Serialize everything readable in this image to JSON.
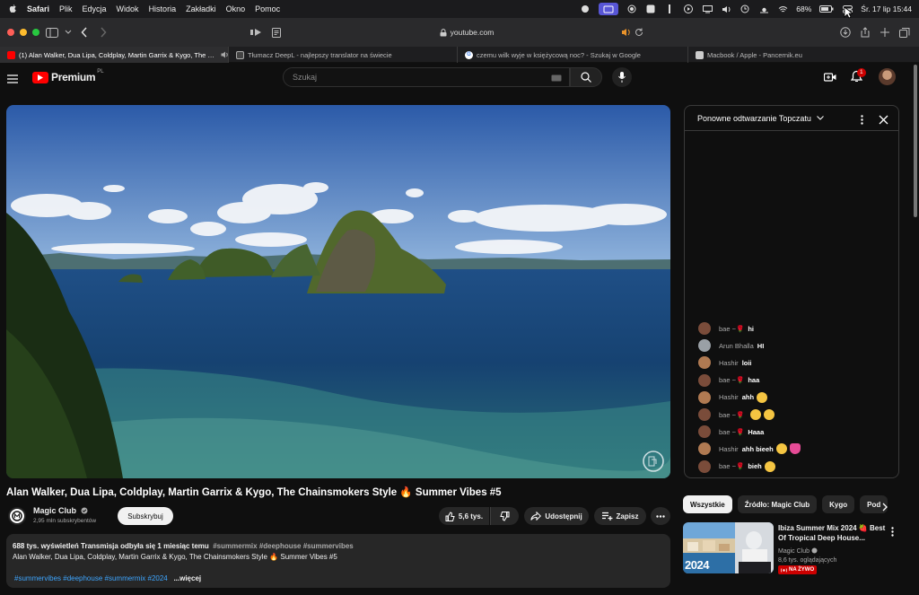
{
  "menubar": {
    "items": [
      "Safari",
      "Plik",
      "Edycja",
      "Widok",
      "Historia",
      "Zakładki",
      "Okno",
      "Pomoc"
    ],
    "battery": "68%",
    "datetime": "Śr. 17 lip  15:44"
  },
  "browser": {
    "url": "youtube.com",
    "tabs": [
      {
        "title": "(1) Alan Walker, Dua Lipa, Coldplay, Martin Garrix & Kygo, The Chains...",
        "active": true
      },
      {
        "title": "Tłumacz DeepL - najlepszy translator na świecie",
        "active": false
      },
      {
        "title": "czemu wilk wyje w księżycową noc? - Szukaj w Google",
        "active": false
      },
      {
        "title": "Macbook / Apple - Pancernik.eu",
        "active": false
      }
    ]
  },
  "youtube": {
    "logo": "Premium",
    "region": "PL",
    "search_placeholder": "Szukaj",
    "notif_count": "1"
  },
  "video": {
    "title": "Alan Walker, Dua Lipa, Coldplay, Martin Garrix & Kygo, The Chainsmokers Style 🔥 Summer Vibes #5",
    "channel": "Magic Club",
    "subscribers": "2,95 mln subskrybentów",
    "subscribe_label": "Subskrybuj",
    "likes": "5,6 tys.",
    "share_label": "Udostępnij",
    "save_label": "Zapisz",
    "views_line": "688 tys. wyświetleń  Transmisja odbyła się 1 miesiąc temu",
    "views_tags": "#summermix #deephouse #summervibes",
    "desc_line": "Alan Walker, Dua Lipa, Coldplay, Martin Garrix & Kygo, The Chainsmokers Style 🔥 Summer Vibes #5",
    "desc_tags": "#summervibes #deephouse #summermix #2024",
    "more_label": "...więcej"
  },
  "chat": {
    "title": "Ponowne odtwarzanie Topczatu",
    "messages": [
      {
        "author": "bae ~🌹",
        "text": "hi",
        "emoji": 0
      },
      {
        "author": "Arun Bhalla",
        "text": "HI",
        "emoji": 0
      },
      {
        "author": "Hashir",
        "text": "loii",
        "emoji": 0
      },
      {
        "author": "bae ~🌹",
        "text": "haa",
        "emoji": 0
      },
      {
        "author": "Hashir",
        "text": "ahh",
        "emoji": 1
      },
      {
        "author": "bae ~🌹",
        "text": "",
        "emoji": 2
      },
      {
        "author": "bae ~🌹",
        "text": "Haaa",
        "emoji": 0
      },
      {
        "author": "Hashir",
        "text": "ahh bieeh",
        "emoji": 2
      },
      {
        "author": "bae ~🌹",
        "text": "bieh",
        "emoji": 1
      }
    ]
  },
  "chips": [
    "Wszystkie",
    "Źródło: Magic Club",
    "Kygo",
    "Pod"
  ],
  "recommendation": {
    "title": "Ibiza Summer Mix 2024 🍓 Best Of Tropical Deep House...",
    "channel": "Magic Club",
    "viewers": "8,6 tys. oglądających",
    "live_label": "NA ŻYWO",
    "thumb_text": "2024"
  }
}
